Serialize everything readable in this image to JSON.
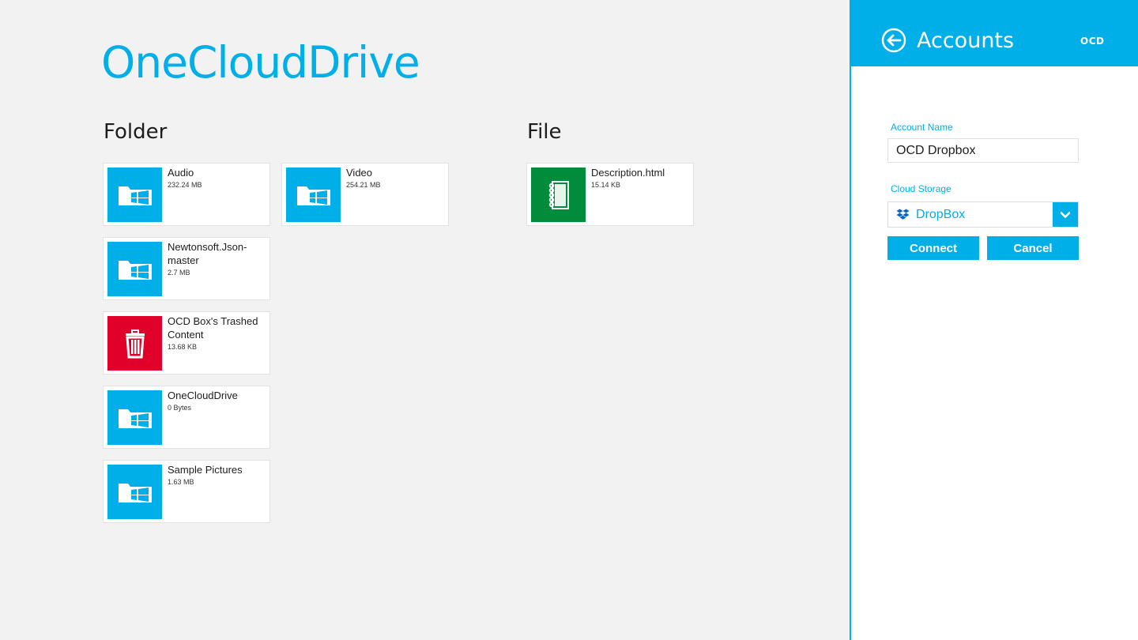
{
  "app": {
    "title": "OneCloudDrive"
  },
  "groups": {
    "folder_label": "Folder",
    "file_label": "File"
  },
  "folders": [
    {
      "name": "Audio",
      "size": "232.24 MB",
      "icon": "folder-windows-icon"
    },
    {
      "name": "Video",
      "size": "254.21 MB",
      "icon": "folder-windows-icon"
    },
    {
      "name": "Newtonsoft.Json-master",
      "size": "2.7 MB",
      "icon": "folder-windows-icon"
    },
    {
      "name": "OCD Box's Trashed Content",
      "size": "13.68 KB",
      "icon": "trash-icon"
    },
    {
      "name": "OneCloudDrive",
      "size": "0 Bytes",
      "icon": "folder-windows-icon"
    },
    {
      "name": "Sample Pictures",
      "size": "1.63 MB",
      "icon": "folder-windows-icon"
    }
  ],
  "files": [
    {
      "name": "Description.html",
      "size": "15.14 KB",
      "icon": "notebook-icon"
    }
  ],
  "accounts_panel": {
    "title": "Accounts",
    "logo_text": "OCD",
    "account_name_label": "Account Name",
    "account_name_value": "OCD Dropbox",
    "cloud_storage_label": "Cloud Storage",
    "cloud_storage_value": "DropBox",
    "cloud_storage_icon": "dropbox-icon",
    "connect_label": "Connect",
    "cancel_label": "Cancel"
  },
  "colors": {
    "accent": "#00aee8",
    "background": "#f2f2f2",
    "trash": "#e0002a",
    "file": "#008c3a"
  }
}
